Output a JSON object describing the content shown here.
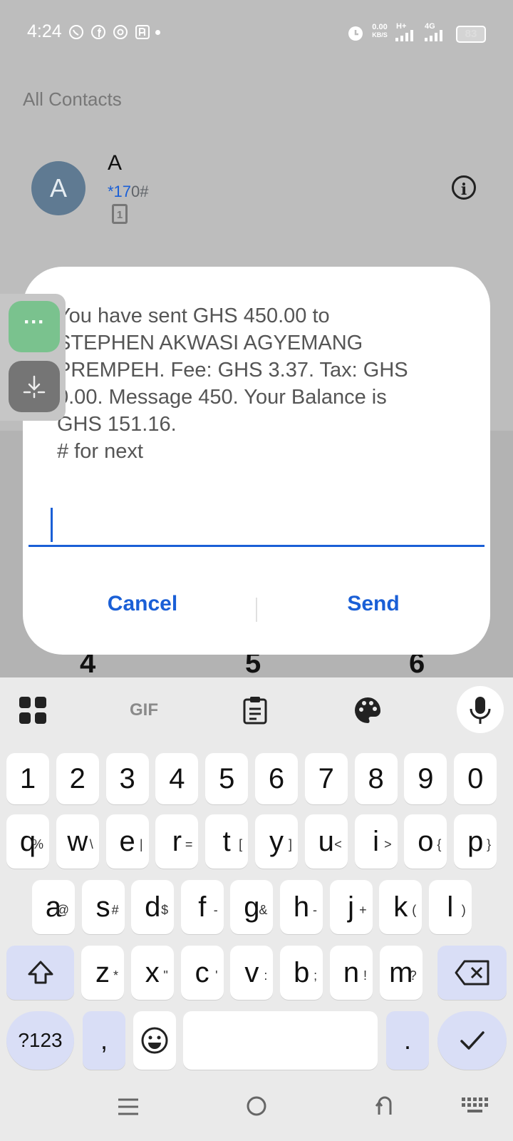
{
  "status_bar": {
    "time": "4:24",
    "net_speed_value": "0.00",
    "net_speed_unit": "KB/S",
    "net_type_1": "H+",
    "net_type_2": "4G",
    "battery": "83"
  },
  "contacts": {
    "section_title": "All Contacts",
    "contact": {
      "initial": "A",
      "name": "A",
      "number_highlight": "*17",
      "number_rest": "0#",
      "sim": "1"
    }
  },
  "dialog": {
    "message": "You have sent GHS 450.00 to\nSTEPHEN AKWASI AGYEMANG\nPREMPEH. Fee: GHS 3.37. Tax: GHS\n0.00. Message 450. Your Balance is\nGHS 151.16.\n# for next",
    "input_value": "",
    "cancel_label": "Cancel",
    "send_label": "Send"
  },
  "dial_digits": [
    "4",
    "5",
    "6"
  ],
  "keyboard": {
    "toolbar": {
      "gif_label": "GIF"
    },
    "number_row": [
      "1",
      "2",
      "3",
      "4",
      "5",
      "6",
      "7",
      "8",
      "9",
      "0"
    ],
    "row1": [
      {
        "key": "q",
        "alt": "%"
      },
      {
        "key": "w",
        "alt": "\\"
      },
      {
        "key": "e",
        "alt": "|"
      },
      {
        "key": "r",
        "alt": "="
      },
      {
        "key": "t",
        "alt": "["
      },
      {
        "key": "y",
        "alt": "]"
      },
      {
        "key": "u",
        "alt": "<"
      },
      {
        "key": "i",
        "alt": ">"
      },
      {
        "key": "o",
        "alt": "{"
      },
      {
        "key": "p",
        "alt": "}"
      }
    ],
    "row2": [
      {
        "key": "a",
        "alt": "@"
      },
      {
        "key": "s",
        "alt": "#"
      },
      {
        "key": "d",
        "alt": "$"
      },
      {
        "key": "f",
        "alt": "-"
      },
      {
        "key": "g",
        "alt": "&"
      },
      {
        "key": "h",
        "alt": "-"
      },
      {
        "key": "j",
        "alt": "+"
      },
      {
        "key": "k",
        "alt": "("
      },
      {
        "key": "l",
        "alt": ")"
      }
    ],
    "row3": [
      {
        "key": "z",
        "alt": "*"
      },
      {
        "key": "x",
        "alt": "\""
      },
      {
        "key": "c",
        "alt": "'"
      },
      {
        "key": "v",
        "alt": ":"
      },
      {
        "key": "b",
        "alt": ";"
      },
      {
        "key": "n",
        "alt": "!"
      },
      {
        "key": "m",
        "alt": "?"
      }
    ],
    "symbols_label": "?123",
    "comma_label": ",",
    "period_label": "."
  },
  "colors": {
    "accent": "#1a5fd6",
    "avatar": "#5f7a92"
  }
}
